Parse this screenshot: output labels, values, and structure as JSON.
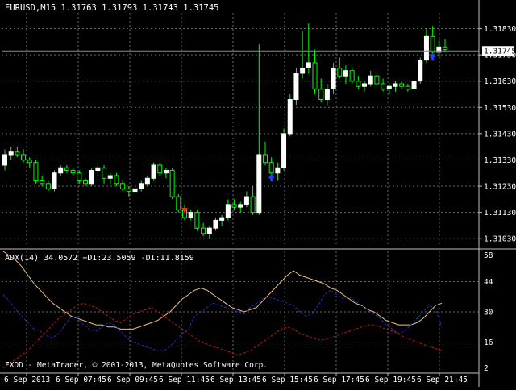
{
  "main": {
    "title": "EURUSD,M15  1.31763 1.31793 1.31743 1.31745",
    "current_price": "1.31745",
    "price_labels": [
      "1.31830",
      "1.31730",
      "1.31630",
      "1.31530",
      "1.31430",
      "1.31330",
      "1.31230",
      "1.31130",
      "1.31030"
    ]
  },
  "indicator": {
    "title": "ADX(14) 34.0572 +DI:23.5059 -DI:11.8159",
    "levels": [
      "58",
      "44",
      "30",
      "16",
      "2"
    ]
  },
  "footer": {
    "copyright": "FXDD - MetaTrader, © 2001-2013, MetaQuotes Software Corp."
  },
  "time_labels": [
    "6 Sep 2013",
    "6 Sep 07:45",
    "6 Sep 09:45",
    "6 Sep 11:45",
    "6 Sep 13:45",
    "6 Sep 15:45",
    "6 Sep 17:45",
    "6 Sep 19:45",
    "6 Sep 21:45"
  ],
  "colors": {
    "background": "#000000",
    "grid": "#6a6a6a",
    "bull_candle": "#ffffff",
    "wick": "#00ff00",
    "adx_line": "#f0c080",
    "plus_di": "#2030c0",
    "minus_di": "#c01818",
    "buy_arrow": "#2040ff",
    "sell_arrow": "#ff2020"
  },
  "chart_data": {
    "type": "candlestick",
    "symbol": "EURUSD",
    "timeframe": "M15",
    "ylim": [
      1.31,
      1.3189
    ],
    "candles": [
      [
        1.3131,
        1.3137,
        1.3129,
        1.3135
      ],
      [
        1.3135,
        1.3138,
        1.3133,
        1.3136
      ],
      [
        1.3136,
        1.3138,
        1.3134,
        1.3135
      ],
      [
        1.3135,
        1.3137,
        1.3132,
        1.3133
      ],
      [
        1.3133,
        1.3134,
        1.313,
        1.3132
      ],
      [
        1.3132,
        1.3133,
        1.3124,
        1.3125
      ],
      [
        1.3125,
        1.3127,
        1.3123,
        1.3124
      ],
      [
        1.3124,
        1.3125,
        1.3121,
        1.3122
      ],
      [
        1.3122,
        1.3129,
        1.3121,
        1.3128
      ],
      [
        1.3128,
        1.3131,
        1.3127,
        1.313
      ],
      [
        1.313,
        1.3131,
        1.3128,
        1.3129
      ],
      [
        1.3129,
        1.313,
        1.3127,
        1.3128
      ],
      [
        1.3128,
        1.3129,
        1.3124,
        1.3125
      ],
      [
        1.3125,
        1.3126,
        1.3123,
        1.3124
      ],
      [
        1.3124,
        1.313,
        1.3123,
        1.3129
      ],
      [
        1.3129,
        1.3132,
        1.3127,
        1.313
      ],
      [
        1.313,
        1.3131,
        1.3124,
        1.3126
      ],
      [
        1.3126,
        1.3128,
        1.3124,
        1.3127
      ],
      [
        1.3127,
        1.3128,
        1.3123,
        1.3124
      ],
      [
        1.3124,
        1.3125,
        1.3121,
        1.3122
      ],
      [
        1.3122,
        1.3123,
        1.3119,
        1.3121
      ],
      [
        1.3121,
        1.3123,
        1.312,
        1.3122
      ],
      [
        1.3122,
        1.3125,
        1.3121,
        1.3124
      ],
      [
        1.3124,
        1.3127,
        1.3123,
        1.3126
      ],
      [
        1.3126,
        1.3132,
        1.3125,
        1.3131
      ],
      [
        1.3131,
        1.3132,
        1.3127,
        1.3128
      ],
      [
        1.3128,
        1.313,
        1.3126,
        1.3129
      ],
      [
        1.3129,
        1.313,
        1.3118,
        1.3119
      ],
      [
        1.3119,
        1.312,
        1.3113,
        1.3114
      ],
      [
        1.3114,
        1.3116,
        1.311,
        1.3111
      ],
      [
        1.3111,
        1.3114,
        1.311,
        1.3113
      ],
      [
        1.3113,
        1.3114,
        1.3106,
        1.3107
      ],
      [
        1.3107,
        1.3109,
        1.3104,
        1.3105
      ],
      [
        1.3105,
        1.3108,
        1.3103,
        1.3107
      ],
      [
        1.3107,
        1.3111,
        1.3106,
        1.311
      ],
      [
        1.311,
        1.3112,
        1.3108,
        1.3111
      ],
      [
        1.3111,
        1.3118,
        1.311,
        1.3116
      ],
      [
        1.3116,
        1.3118,
        1.3114,
        1.3115
      ],
      [
        1.3115,
        1.3117,
        1.3113,
        1.3116
      ],
      [
        1.3116,
        1.3121,
        1.3115,
        1.3119
      ],
      [
        1.3119,
        1.3123,
        1.3112,
        1.3113
      ],
      [
        1.3113,
        1.3177,
        1.3112,
        1.3135
      ],
      [
        1.3135,
        1.314,
        1.3131,
        1.3132
      ],
      [
        1.3132,
        1.3134,
        1.3126,
        1.3128
      ],
      [
        1.3128,
        1.3132,
        1.3125,
        1.313
      ],
      [
        1.313,
        1.3145,
        1.3129,
        1.3143
      ],
      [
        1.3143,
        1.3158,
        1.3142,
        1.3156
      ],
      [
        1.3156,
        1.3168,
        1.3154,
        1.3166
      ],
      [
        1.3166,
        1.3182,
        1.3164,
        1.3168
      ],
      [
        1.3168,
        1.3185,
        1.3166,
        1.317
      ],
      [
        1.317,
        1.3175,
        1.3158,
        1.316
      ],
      [
        1.316,
        1.3164,
        1.3155,
        1.3156
      ],
      [
        1.3156,
        1.3162,
        1.3154,
        1.316
      ],
      [
        1.316,
        1.317,
        1.3158,
        1.3168
      ],
      [
        1.3168,
        1.3172,
        1.3164,
        1.3165
      ],
      [
        1.3165,
        1.3169,
        1.3162,
        1.3167
      ],
      [
        1.3167,
        1.3168,
        1.3162,
        1.3163
      ],
      [
        1.3163,
        1.3165,
        1.316,
        1.3161
      ],
      [
        1.3161,
        1.3163,
        1.3159,
        1.3162
      ],
      [
        1.3162,
        1.3167,
        1.3161,
        1.3165
      ],
      [
        1.3165,
        1.3166,
        1.3161,
        1.3162
      ],
      [
        1.3162,
        1.3164,
        1.3159,
        1.316
      ],
      [
        1.316,
        1.3162,
        1.3158,
        1.3161
      ],
      [
        1.3161,
        1.3163,
        1.3159,
        1.3162
      ],
      [
        1.3162,
        1.3163,
        1.316,
        1.3161
      ],
      [
        1.3161,
        1.3162,
        1.3159,
        1.316
      ],
      [
        1.316,
        1.3164,
        1.3159,
        1.3163
      ],
      [
        1.3163,
        1.3172,
        1.3162,
        1.3171
      ],
      [
        1.3171,
        1.3183,
        1.317,
        1.318
      ],
      [
        1.318,
        1.3184,
        1.3172,
        1.3174
      ],
      [
        1.3174,
        1.3179,
        1.3172,
        1.3176
      ],
      [
        1.3176,
        1.3179,
        1.3174,
        1.3175
      ]
    ],
    "signals": [
      {
        "type": "sell",
        "candle_index": 29
      },
      {
        "type": "buy",
        "candle_index": 43
      },
      {
        "type": "buy",
        "candle_index": 69
      }
    ],
    "indicator": {
      "name": "ADX",
      "period": 14,
      "ylim": [
        2,
        58
      ],
      "adx": [
        58,
        56,
        54,
        51,
        47,
        43,
        40,
        37,
        34,
        32,
        30,
        28,
        27,
        26,
        25,
        24,
        24,
        23,
        23,
        22,
        22,
        22,
        23,
        24,
        25,
        26,
        28,
        30,
        33,
        36,
        38,
        40,
        41,
        40,
        38,
        36,
        34,
        32,
        31,
        30,
        31,
        32,
        35,
        38,
        41,
        44,
        47,
        49,
        47,
        46,
        45,
        44,
        43,
        41,
        40,
        38,
        36,
        34,
        33,
        31,
        30,
        28,
        26,
        25,
        24,
        24,
        24,
        25,
        27,
        30,
        33,
        34
      ],
      "plus_di": [
        38,
        35,
        31,
        28,
        25,
        22,
        21,
        19,
        18,
        20,
        24,
        28,
        27,
        24,
        22,
        21,
        23,
        25,
        24,
        21,
        18,
        16,
        15,
        14,
        13,
        12,
        12,
        14,
        17,
        20,
        22,
        28,
        30,
        32,
        34,
        33,
        32,
        31,
        30,
        29,
        32,
        34,
        36,
        37,
        36,
        35,
        34,
        33,
        30,
        28,
        29,
        33,
        38,
        40,
        38,
        36,
        37,
        35,
        33,
        31,
        29,
        27,
        24,
        22,
        20,
        21,
        24,
        27,
        30,
        33,
        31,
        23
      ],
      "minus_di": [
        4,
        6,
        8,
        10,
        12,
        15,
        18,
        21,
        24,
        27,
        29,
        31,
        33,
        34,
        33,
        32,
        30,
        28,
        26,
        25,
        27,
        29,
        30,
        31,
        32,
        30,
        28,
        26,
        24,
        22,
        20,
        18,
        16,
        15,
        14,
        13,
        12,
        11,
        10,
        11,
        12,
        14,
        16,
        18,
        20,
        22,
        23,
        22,
        20,
        19,
        18,
        17,
        17,
        18,
        19,
        20,
        21,
        22,
        23,
        24,
        24,
        23,
        22,
        21,
        20,
        18,
        17,
        16,
        15,
        14,
        13,
        12
      ]
    }
  }
}
